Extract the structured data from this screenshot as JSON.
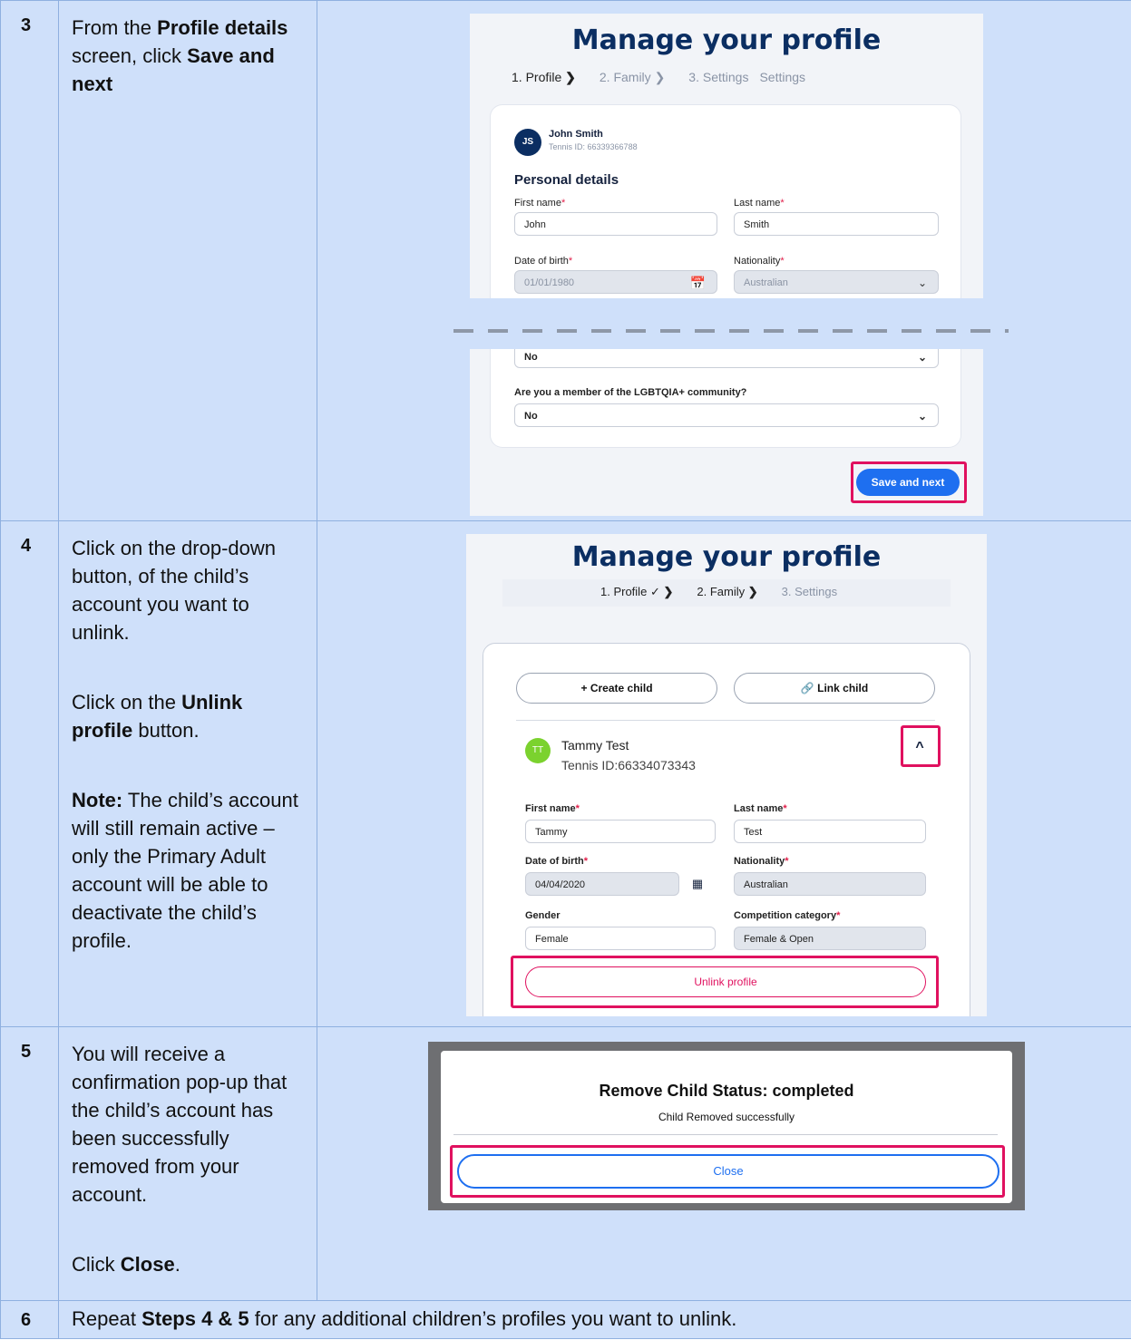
{
  "rows": [
    {
      "number": "3",
      "desc": {
        "t1": "From the ",
        "b1": "Profile details",
        "t2": " screen, click ",
        "b2": "Save and next"
      },
      "ui": {
        "title": "Manage your profile",
        "steps": [
          "1. Profile",
          "2. Family",
          "3. Settings",
          "Settings"
        ],
        "chevron": "❯",
        "avatar_initials": "JS",
        "user_name": "John Smith",
        "tennis_id": "Tennis ID: 66339366788",
        "section_title": "Personal details",
        "first_name_label": "First name",
        "first_name_value": "John",
        "last_name_label": "Last name",
        "last_name_value": "Smith",
        "dob_label": "Date of birth",
        "dob_value": "01/01/1980",
        "nationality_label": "Nationality",
        "nationality_value": "Australian",
        "first_select_value": "No",
        "lgbtqia_label": "Are you a member of the LGBTQIA+ community?",
        "lgbtqia_value": "No",
        "save_button": "Save and next",
        "required_mark": "*"
      }
    },
    {
      "number": "4",
      "desc": {
        "p1": "Click on the drop-down button, of the child’s account you want to unlink.",
        "p2a": "Click on the ",
        "p2b": "Unlink profile",
        "p2c": " button.",
        "p3a": "Note:",
        "p3b": " The child’s account will still remain active – only the Primary Adult account will be able to deactivate the child’s profile."
      },
      "ui": {
        "title": "Manage your profile",
        "step1": "1. Profile",
        "check": "✓",
        "chevron": "❯",
        "step2": "2. Family",
        "step3": "3. Settings",
        "create_child_icon": "+",
        "create_child": "Create child",
        "link_child_icon": "🔗",
        "link_child": "Link child",
        "child_initials": "TT",
        "child_name": "Tammy Test",
        "child_tennis_id": "Tennis ID:66334073343",
        "collapse_icon": "^",
        "first_name_label": "First name",
        "first_name_value": "Tammy",
        "last_name_label": "Last name",
        "last_name_value": "Test",
        "dob_label": "Date of birth",
        "dob_value": "04/04/2020",
        "calendar_icon": "▦",
        "nationality_label": "Nationality",
        "nationality_value": "Australian",
        "gender_label": "Gender",
        "gender_value": "Female",
        "competition_label": "Competition category",
        "competition_value": "Female & Open",
        "unlink_button": "Unlink profile",
        "required_mark": "*"
      }
    },
    {
      "number": "5",
      "desc": {
        "p1": "You will receive a confirmation pop-up that the child’s account has been successfully removed from your account.",
        "p2a": "Click ",
        "p2b": "Close",
        "p2c": "."
      },
      "ui": {
        "dialog_title": "Remove Child Status: completed",
        "dialog_message": "Child Removed successfully",
        "close_button": "Close"
      }
    },
    {
      "number": "6",
      "desc": {
        "t1": "Repeat ",
        "b1": "Steps 4 & 5",
        "t2": " for any additional children’s profiles you want to unlink."
      }
    }
  ],
  "colors": {
    "accent": "#e0115f",
    "primary_button": "#1e6ff0",
    "heading": "#0b2e62",
    "row_bg": "#cfe0fa"
  },
  "icons": [
    "calendar-icon",
    "chevron-down-icon",
    "chevron-up-icon",
    "link-icon",
    "plus-icon",
    "check-icon"
  ]
}
